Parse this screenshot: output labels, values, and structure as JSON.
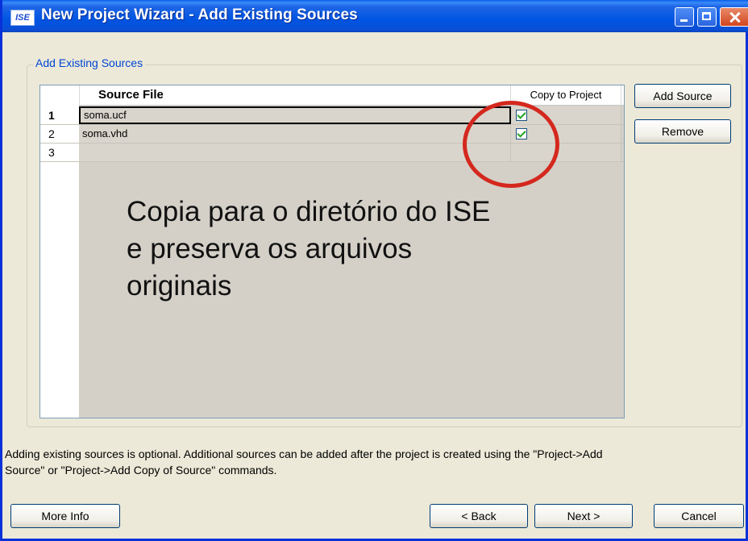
{
  "window": {
    "title": "New Project Wizard - Add Existing Sources",
    "app_icon": "ISE"
  },
  "group": {
    "label": "Add Existing Sources"
  },
  "table": {
    "headers": {
      "source_file": "Source File",
      "copy_to_project": "Copy to Project"
    },
    "rows": [
      {
        "num": "1",
        "source": "soma.ucf",
        "copy": true
      },
      {
        "num": "2",
        "source": "soma.vhd",
        "copy": true
      },
      {
        "num": "3",
        "source": "",
        "copy": false
      }
    ]
  },
  "buttons": {
    "add_source": "Add Source",
    "remove": "Remove",
    "more_info": "More Info",
    "back": "< Back",
    "next": "Next >",
    "cancel": "Cancel"
  },
  "annotation": {
    "line1": "Copia para o diretório do ISE",
    "line2": "e  preserva os arquivos",
    "line3": "originais"
  },
  "info": {
    "line1": "Adding existing sources is optional. Additional sources can be added after the project is created using the \"Project->Add",
    "line2": "Source\" or \"Project->Add Copy of Source\" commands."
  },
  "colors": {
    "titlebar": "#0055e3",
    "annotation_circle": "#d4281e"
  }
}
